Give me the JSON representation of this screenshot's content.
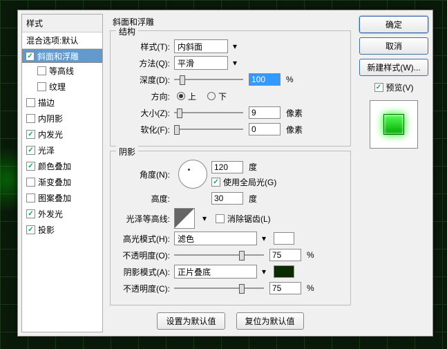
{
  "sidebar": {
    "header": "样式",
    "blend": "混合选项:默认",
    "items": [
      {
        "label": "斜面和浮雕",
        "checked": true,
        "selected": true
      },
      {
        "label": "等高线",
        "checked": false,
        "sub": true
      },
      {
        "label": "纹理",
        "checked": false,
        "sub": true
      },
      {
        "label": "描边",
        "checked": false
      },
      {
        "label": "内阴影",
        "checked": false
      },
      {
        "label": "内发光",
        "checked": true
      },
      {
        "label": "光泽",
        "checked": true
      },
      {
        "label": "颜色叠加",
        "checked": true
      },
      {
        "label": "渐变叠加",
        "checked": false
      },
      {
        "label": "图案叠加",
        "checked": false
      },
      {
        "label": "外发光",
        "checked": true
      },
      {
        "label": "投影",
        "checked": true
      }
    ]
  },
  "main": {
    "title": "斜面和浮雕",
    "structure": {
      "legend": "结构",
      "style_label": "样式(T):",
      "style_value": "内斜面",
      "method_label": "方法(Q):",
      "method_value": "平滑",
      "depth_label": "深度(D):",
      "depth_value": "100",
      "depth_unit": "%",
      "direction_label": "方向:",
      "up": "上",
      "down": "下",
      "size_label": "大小(Z):",
      "size_value": "9",
      "size_unit": "像素",
      "soften_label": "软化(F):",
      "soften_value": "0",
      "soften_unit": "像素"
    },
    "shadow": {
      "legend": "阴影",
      "angle_label": "角度(N):",
      "angle_value": "120",
      "angle_unit": "度",
      "global_label": "使用全局光(G)",
      "altitude_label": "高度:",
      "altitude_value": "30",
      "altitude_unit": "度",
      "gloss_label": "光泽等高线:",
      "antialias_label": "消除锯齿(L)",
      "hmode_label": "高光模式(H):",
      "hmode_value": "滤色",
      "hcolor": "#ffffff",
      "hopacity_label": "不透明度(O):",
      "hopacity_value": "75",
      "hopacity_unit": "%",
      "smode_label": "阴影模式(A):",
      "smode_value": "正片叠底",
      "scolor": "#0a2a00",
      "sopacity_label": "不透明度(C):",
      "sopacity_value": "75",
      "sopacity_unit": "%"
    },
    "set_default": "设置为默认值",
    "reset_default": "复位为默认值"
  },
  "side": {
    "ok": "确定",
    "cancel": "取消",
    "new_style": "新建样式(W)...",
    "preview": "预览(V)"
  }
}
